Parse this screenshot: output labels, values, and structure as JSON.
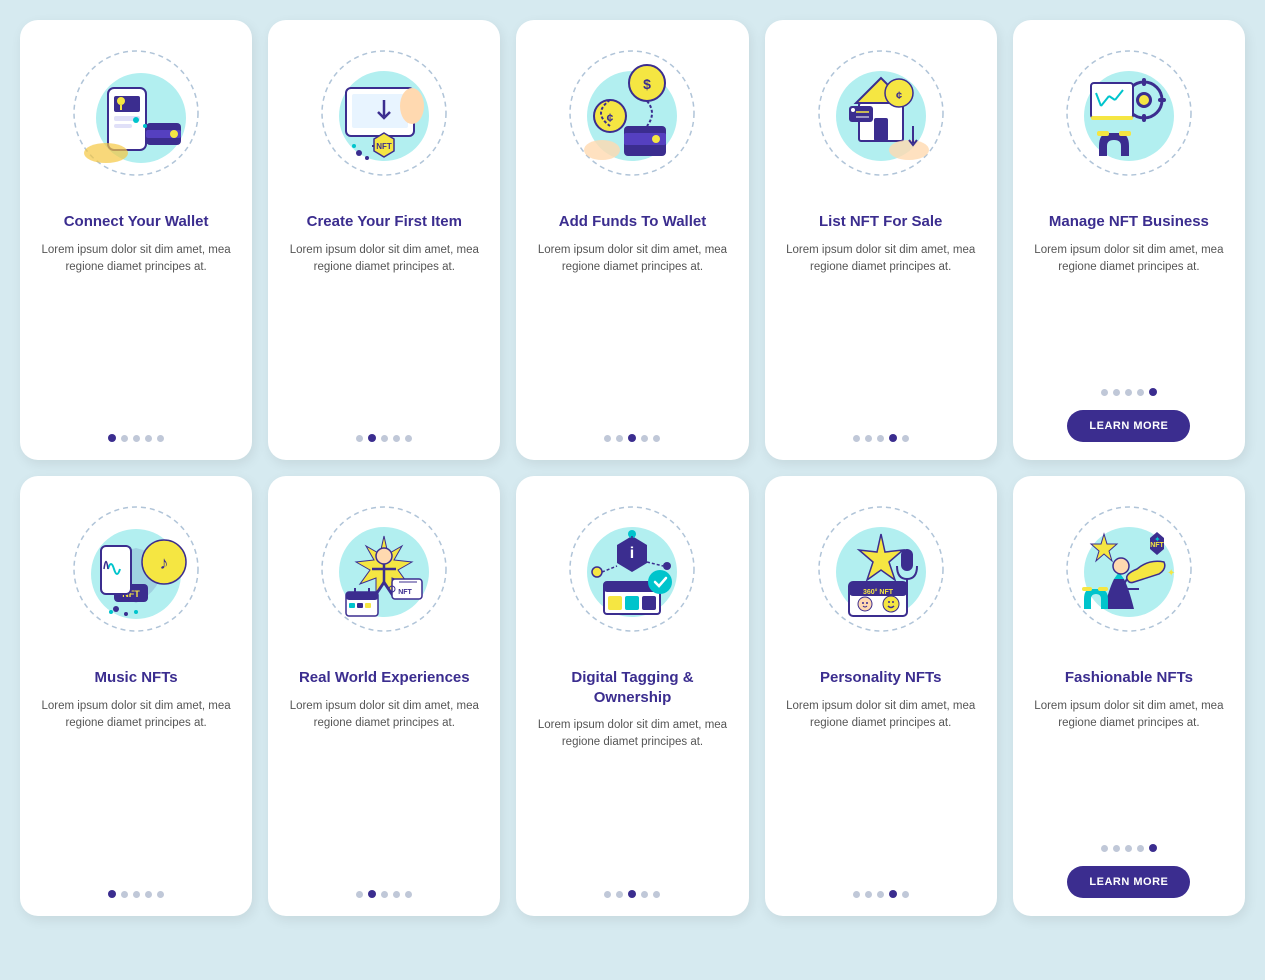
{
  "cards": [
    {
      "id": "connect-wallet",
      "title": "Connect Your Wallet",
      "body": "Lorem ipsum dolor sit dim amet, mea regione diamet principes at.",
      "dots": [
        1,
        0,
        0,
        0,
        0
      ],
      "hasButton": false,
      "buttonLabel": ""
    },
    {
      "id": "create-first-item",
      "title": "Create Your First Item",
      "body": "Lorem ipsum dolor sit dim amet, mea regione diamet principes at.",
      "dots": [
        0,
        1,
        0,
        0,
        0
      ],
      "hasButton": false,
      "buttonLabel": ""
    },
    {
      "id": "add-funds",
      "title": "Add Funds To Wallet",
      "body": "Lorem ipsum dolor sit dim amet, mea regione diamet principes at.",
      "dots": [
        0,
        0,
        1,
        0,
        0
      ],
      "hasButton": false,
      "buttonLabel": ""
    },
    {
      "id": "list-nft",
      "title": "List NFT For Sale",
      "body": "Lorem ipsum dolor sit dim amet, mea regione diamet principes at.",
      "dots": [
        0,
        0,
        0,
        1,
        0
      ],
      "hasButton": false,
      "buttonLabel": ""
    },
    {
      "id": "manage-nft",
      "title": "Manage NFT Business",
      "body": "Lorem ipsum dolor sit dim amet, mea regione diamet principes at.",
      "dots": [
        0,
        0,
        0,
        0,
        1
      ],
      "hasButton": true,
      "buttonLabel": "LEARN MORE"
    },
    {
      "id": "music-nfts",
      "title": "Music NFTs",
      "body": "Lorem ipsum dolor sit dim amet, mea regione diamet principes at.",
      "dots": [
        1,
        0,
        0,
        0,
        0
      ],
      "hasButton": false,
      "buttonLabel": ""
    },
    {
      "id": "real-world",
      "title": "Real World Experiences",
      "body": "Lorem ipsum dolor sit dim amet, mea regione diamet principes at.",
      "dots": [
        0,
        1,
        0,
        0,
        0
      ],
      "hasButton": false,
      "buttonLabel": ""
    },
    {
      "id": "digital-tagging",
      "title": "Digital Tagging & Ownership",
      "body": "Lorem ipsum dolor sit dim amet, mea regione diamet principes at.",
      "dots": [
        0,
        0,
        1,
        0,
        0
      ],
      "hasButton": false,
      "buttonLabel": ""
    },
    {
      "id": "personality-nfts",
      "title": "Personality NFTs",
      "body": "Lorem ipsum dolor sit dim amet, mea regione diamet principes at.",
      "dots": [
        0,
        0,
        0,
        1,
        0
      ],
      "hasButton": false,
      "buttonLabel": ""
    },
    {
      "id": "fashionable-nfts",
      "title": "Fashionable NFTs",
      "body": "Lorem ipsum dolor sit dim amet, mea regione diamet principes at.",
      "dots": [
        0,
        0,
        0,
        0,
        1
      ],
      "hasButton": true,
      "buttonLabel": "LEARN MORE"
    }
  ]
}
